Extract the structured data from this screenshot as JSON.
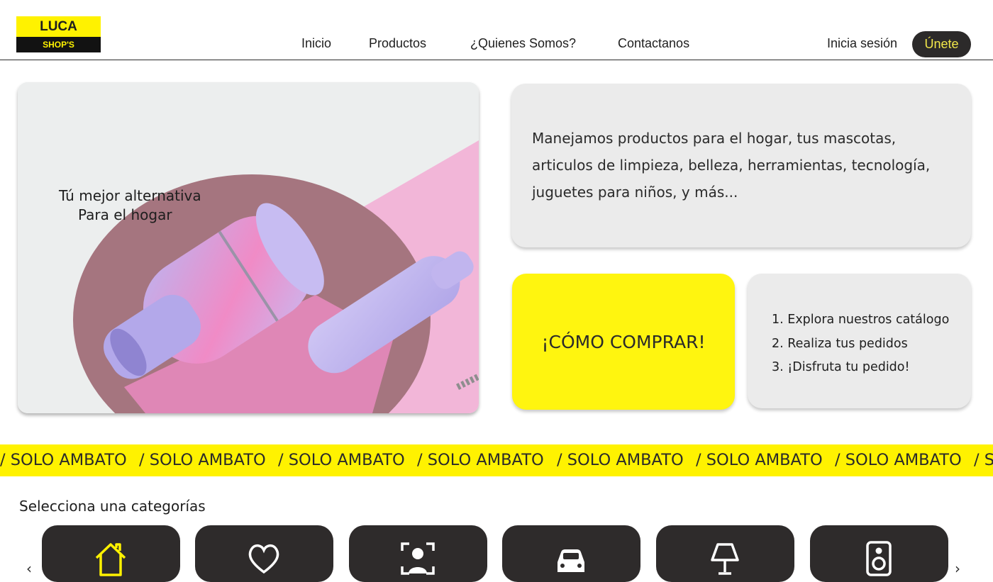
{
  "brand": {
    "top": "LUCA",
    "bottom": "SHOP'S"
  },
  "nav": {
    "inicio": "Inicio",
    "productos": "Productos",
    "quienes": "¿Quienes Somos?",
    "contactanos": "Contactanos",
    "login": "Inicia sesión",
    "join": "Únete"
  },
  "hero": {
    "line1": "Tú mejor alternativa",
    "line2": "Para el hogar"
  },
  "info": {
    "text": "Manejamos productos para el hogar, tus mascotas, articulos de limpieza, belleza, herramientas, tecnología, juguetes para niños, y más..."
  },
  "howto": {
    "label": "¡CÓMO COMPRAR!"
  },
  "steps": [
    "1. Explora nuestros catálogo",
    "2. Realiza tus pedidos",
    "3. ¡Disfruta tu pedido!"
  ],
  "marquee": {
    "text": "/ SOLO AMBATO"
  },
  "categories": {
    "title": "Selecciona una categorías",
    "items": [
      {
        "icon": "home-icon"
      },
      {
        "icon": "heart-icon"
      },
      {
        "icon": "face-scan-icon"
      },
      {
        "icon": "car-icon"
      },
      {
        "icon": "lamp-icon"
      },
      {
        "icon": "speaker-icon"
      }
    ],
    "prev": "‹",
    "next": "›"
  },
  "colors": {
    "accent_yellow": "#fff200",
    "dark": "#2e2b2b",
    "card_gray": "#ebebeb"
  }
}
